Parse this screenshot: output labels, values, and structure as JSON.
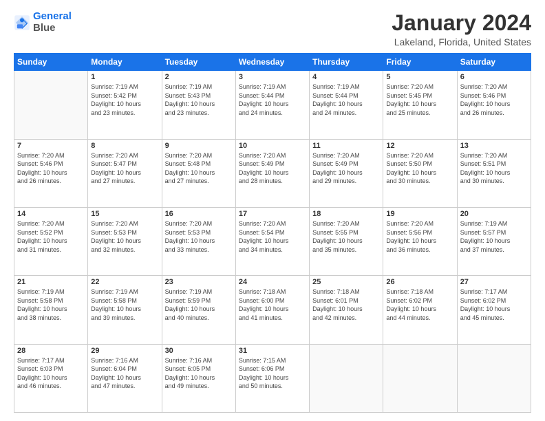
{
  "logo": {
    "line1": "General",
    "line2": "Blue"
  },
  "title": "January 2024",
  "subtitle": "Lakeland, Florida, United States",
  "weekdays": [
    "Sunday",
    "Monday",
    "Tuesday",
    "Wednesday",
    "Thursday",
    "Friday",
    "Saturday"
  ],
  "days": [
    {
      "num": "",
      "info": ""
    },
    {
      "num": "1",
      "info": "Sunrise: 7:19 AM\nSunset: 5:42 PM\nDaylight: 10 hours\nand 23 minutes."
    },
    {
      "num": "2",
      "info": "Sunrise: 7:19 AM\nSunset: 5:43 PM\nDaylight: 10 hours\nand 23 minutes."
    },
    {
      "num": "3",
      "info": "Sunrise: 7:19 AM\nSunset: 5:44 PM\nDaylight: 10 hours\nand 24 minutes."
    },
    {
      "num": "4",
      "info": "Sunrise: 7:19 AM\nSunset: 5:44 PM\nDaylight: 10 hours\nand 24 minutes."
    },
    {
      "num": "5",
      "info": "Sunrise: 7:20 AM\nSunset: 5:45 PM\nDaylight: 10 hours\nand 25 minutes."
    },
    {
      "num": "6",
      "info": "Sunrise: 7:20 AM\nSunset: 5:46 PM\nDaylight: 10 hours\nand 26 minutes."
    },
    {
      "num": "7",
      "info": "Sunrise: 7:20 AM\nSunset: 5:46 PM\nDaylight: 10 hours\nand 26 minutes."
    },
    {
      "num": "8",
      "info": "Sunrise: 7:20 AM\nSunset: 5:47 PM\nDaylight: 10 hours\nand 27 minutes."
    },
    {
      "num": "9",
      "info": "Sunrise: 7:20 AM\nSunset: 5:48 PM\nDaylight: 10 hours\nand 27 minutes."
    },
    {
      "num": "10",
      "info": "Sunrise: 7:20 AM\nSunset: 5:49 PM\nDaylight: 10 hours\nand 28 minutes."
    },
    {
      "num": "11",
      "info": "Sunrise: 7:20 AM\nSunset: 5:49 PM\nDaylight: 10 hours\nand 29 minutes."
    },
    {
      "num": "12",
      "info": "Sunrise: 7:20 AM\nSunset: 5:50 PM\nDaylight: 10 hours\nand 30 minutes."
    },
    {
      "num": "13",
      "info": "Sunrise: 7:20 AM\nSunset: 5:51 PM\nDaylight: 10 hours\nand 30 minutes."
    },
    {
      "num": "14",
      "info": "Sunrise: 7:20 AM\nSunset: 5:52 PM\nDaylight: 10 hours\nand 31 minutes."
    },
    {
      "num": "15",
      "info": "Sunrise: 7:20 AM\nSunset: 5:53 PM\nDaylight: 10 hours\nand 32 minutes."
    },
    {
      "num": "16",
      "info": "Sunrise: 7:20 AM\nSunset: 5:53 PM\nDaylight: 10 hours\nand 33 minutes."
    },
    {
      "num": "17",
      "info": "Sunrise: 7:20 AM\nSunset: 5:54 PM\nDaylight: 10 hours\nand 34 minutes."
    },
    {
      "num": "18",
      "info": "Sunrise: 7:20 AM\nSunset: 5:55 PM\nDaylight: 10 hours\nand 35 minutes."
    },
    {
      "num": "19",
      "info": "Sunrise: 7:20 AM\nSunset: 5:56 PM\nDaylight: 10 hours\nand 36 minutes."
    },
    {
      "num": "20",
      "info": "Sunrise: 7:19 AM\nSunset: 5:57 PM\nDaylight: 10 hours\nand 37 minutes."
    },
    {
      "num": "21",
      "info": "Sunrise: 7:19 AM\nSunset: 5:58 PM\nDaylight: 10 hours\nand 38 minutes."
    },
    {
      "num": "22",
      "info": "Sunrise: 7:19 AM\nSunset: 5:58 PM\nDaylight: 10 hours\nand 39 minutes."
    },
    {
      "num": "23",
      "info": "Sunrise: 7:19 AM\nSunset: 5:59 PM\nDaylight: 10 hours\nand 40 minutes."
    },
    {
      "num": "24",
      "info": "Sunrise: 7:18 AM\nSunset: 6:00 PM\nDaylight: 10 hours\nand 41 minutes."
    },
    {
      "num": "25",
      "info": "Sunrise: 7:18 AM\nSunset: 6:01 PM\nDaylight: 10 hours\nand 42 minutes."
    },
    {
      "num": "26",
      "info": "Sunrise: 7:18 AM\nSunset: 6:02 PM\nDaylight: 10 hours\nand 44 minutes."
    },
    {
      "num": "27",
      "info": "Sunrise: 7:17 AM\nSunset: 6:02 PM\nDaylight: 10 hours\nand 45 minutes."
    },
    {
      "num": "28",
      "info": "Sunrise: 7:17 AM\nSunset: 6:03 PM\nDaylight: 10 hours\nand 46 minutes."
    },
    {
      "num": "29",
      "info": "Sunrise: 7:16 AM\nSunset: 6:04 PM\nDaylight: 10 hours\nand 47 minutes."
    },
    {
      "num": "30",
      "info": "Sunrise: 7:16 AM\nSunset: 6:05 PM\nDaylight: 10 hours\nand 49 minutes."
    },
    {
      "num": "31",
      "info": "Sunrise: 7:15 AM\nSunset: 6:06 PM\nDaylight: 10 hours\nand 50 minutes."
    },
    {
      "num": "",
      "info": ""
    },
    {
      "num": "",
      "info": ""
    },
    {
      "num": "",
      "info": ""
    },
    {
      "num": "",
      "info": ""
    }
  ]
}
